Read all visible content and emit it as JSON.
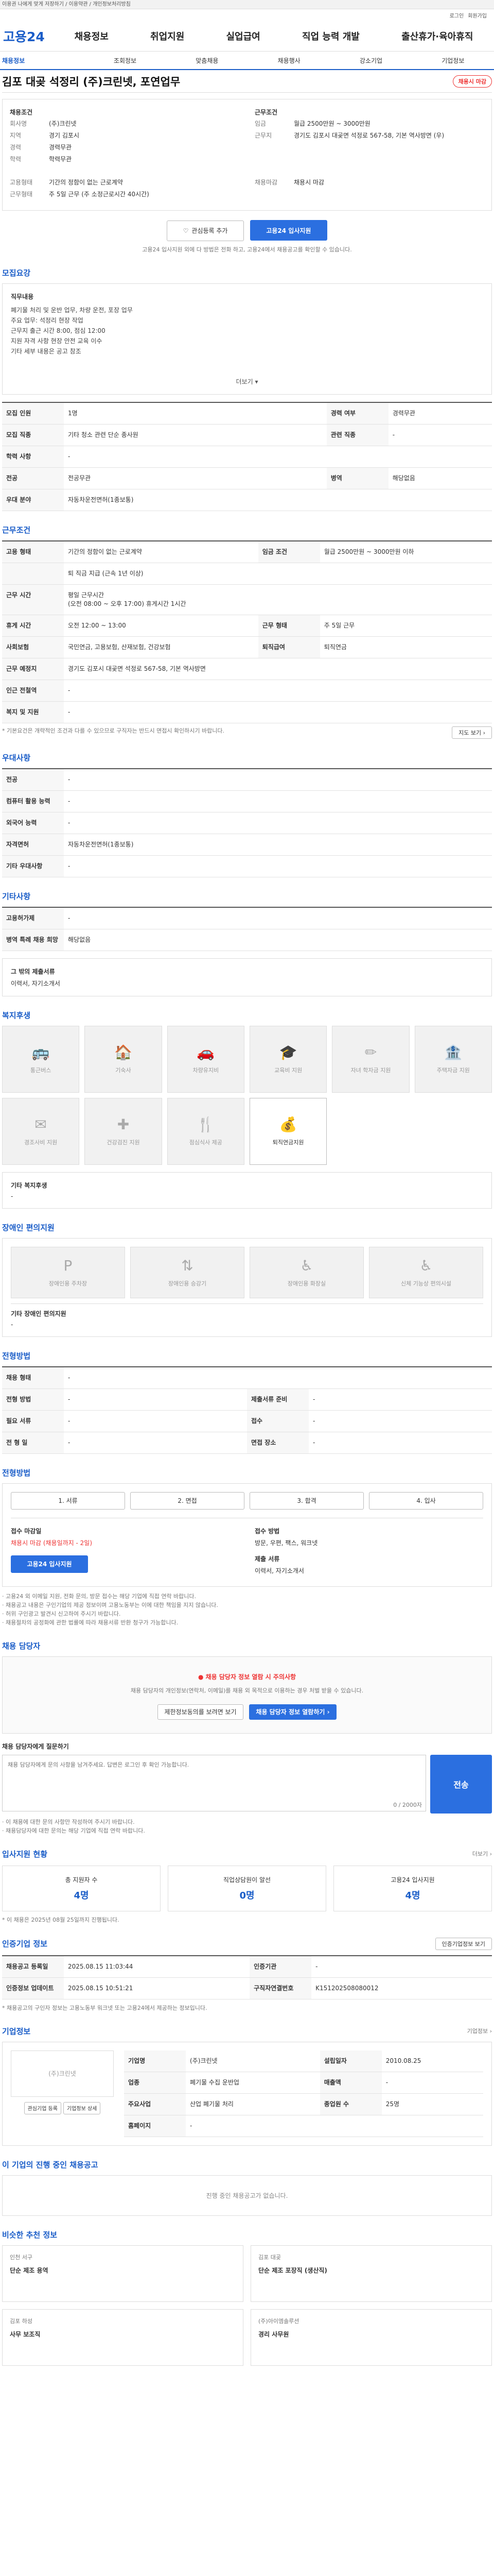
{
  "topbar": "이용권 나에게 맞게 저장하기 / 이용약관 / 개인정보처리방침",
  "util": [
    "로그인",
    "회원가입"
  ],
  "logo": "고용24",
  "gnb": [
    "채용정보",
    "취업지원",
    "실업급여",
    "직업 능력 개발",
    "출산휴가·육아휴직"
  ],
  "subnav": [
    "채용정보",
    "조회정보",
    "맞춤채용",
    "채용행사",
    "강소기업",
    "기업정보"
  ],
  "job": {
    "title": "김포 대곶 석정리 (주)크린넷, 포연업무",
    "badge": "채용시 마감",
    "left_label": "채용조건",
    "company_k": "회사명",
    "company": "(주)크린넷",
    "loc_k": "지역",
    "loc": "경기 김포시",
    "career_k": "경력",
    "career": "경력무관",
    "edu_k": "학력",
    "edu": "학력무관",
    "right_label": "근무조건",
    "pay_k": "임금",
    "pay": "월급 2500만원 ~ 3000만원",
    "addr_k": "근무지",
    "addr": "경기도 김포시 대곶면 석정로 567-58, 기본 역사방면 (우)",
    "emp_k": "고용형태",
    "emp": "기간의 정함이 없는 근로계약",
    "type_k": "근무형태",
    "type": "주 5일 근무 (주 소정근로시간 40시간)",
    "hire_label": "채용마감",
    "hire": "채용시 마감",
    "btn_save": "관심등록 추가",
    "btn_apply": "고용24 입사지원",
    "note": "고용24 입사지원 외에 다 방법은 전화 하고, 고용24에서 채용공고를 확인할 수 있습니다."
  },
  "recruit": {
    "title": "모집요강",
    "job_k": "직무내용",
    "job_v": "폐기물 처리 및 운반 업무, 차량 운전, 포장 업무\n주요 업무: 석정리 현장 작업\n근무지 출근 시간 8:00, 점심 12:00\n지원 자격 사항 현장 안전 교육 이수\n기타 세부 내용은 공고 참조",
    "more": "더보기 ▾",
    "rows": [
      [
        "모집 인원",
        "1명",
        "경력 여부",
        "경력무관"
      ],
      [
        "모집 직종",
        "기타 청소 관련 단순 종사원",
        "관련 직종",
        "-"
      ],
      [
        "학력 사항",
        "-",
        "",
        ""
      ],
      [
        "전공",
        "전공무관",
        "병역",
        "해당없음"
      ],
      [
        "우대 분야",
        "자동차운전면허(1종보통)",
        "",
        ""
      ]
    ]
  },
  "work": {
    "title": "근무조건",
    "rows": [
      [
        "고용 형태",
        "기간의 정함이 없는 근로계약",
        "임금 조건",
        "월급 2500만원 ~ 3000만원 이하"
      ],
      [
        "",
        "퇴 직금 지급 (근속 1년 이상)",
        "",
        ""
      ],
      [
        "근무 시간",
        "평일 근무시간\n(오전 08:00 ~ 오후 17:00) 휴게시간 1시간",
        "",
        ""
      ],
      [
        "휴게 시간",
        "오전 12:00 ~ 13:00",
        "근무 형태",
        "주 5일 근무"
      ],
      [
        "사회보험",
        "국민연금, 고용보험, 산재보험, 건강보험",
        "퇴직급여",
        "퇴직연금"
      ],
      [
        "근무 예정지",
        "경기도 김포시 대곶면 석정로 567-58, 기본 역사방면",
        "",
        ""
      ],
      [
        "인근 전철역",
        "-",
        "",
        ""
      ],
      [
        "복지 및 지원",
        "-",
        "",
        ""
      ]
    ],
    "note": "* 기본요건은 개략적인 조건과 다를 수 있으므로 구직자는 반드시 면접시 확인하시기 바랍니다.",
    "map_btn": "지도 보기 ›"
  },
  "pref": {
    "title": "우대사항",
    "rows": [
      [
        "전공",
        "-"
      ],
      [
        "컴퓨터 활용 능력",
        "-"
      ],
      [
        "외국어 능력",
        "-"
      ],
      [
        "자격면허",
        "자동차운전면허(1종보통)"
      ],
      [
        "기타 우대사항",
        "-"
      ]
    ]
  },
  "etc": {
    "title": "기타사항",
    "rows": [
      [
        "고용허가제",
        "-"
      ],
      [
        "병역 특례 채용 희망",
        "해당없음"
      ]
    ],
    "other_k": "그 밖의 제출서류",
    "other_v": "이력서, 자기소개서"
  },
  "welfare": {
    "title": "복지후생",
    "tiles": [
      "통근버스",
      "기숙사",
      "차량유지비",
      "교육비 지원",
      "자녀 학자금 지원",
      "주택자금 지원",
      "경조사비 지원",
      "건강검진 지원",
      "점심식사 제공",
      "퇴직연금지원"
    ],
    "active": [
      9
    ],
    "extra_k": "기타 복지후생",
    "extra_v": "-"
  },
  "disab": {
    "title": "장애인 편의지원",
    "tiles": [
      "장애인용 주차장",
      "장애인용 승강기",
      "장애인용 화장실",
      "신체 기능상 편의시설"
    ],
    "extra_k": "기타 장애인 편의지원",
    "extra_v": "-"
  },
  "process": {
    "title": "전형방법",
    "rows": [
      [
        "채용 형태",
        "-",
        "",
        ""
      ],
      [
        "전형 방법",
        "-",
        "제출서류 준비",
        "-"
      ],
      [
        "필요 서류",
        "-",
        "접수",
        "-"
      ],
      [
        "전 형 일",
        "-",
        "면접 장소",
        "-"
      ]
    ]
  },
  "steps": {
    "title": "전형방법",
    "list": [
      "서류",
      "면접",
      "합격",
      "입사"
    ],
    "recv_k": "접수 마감일",
    "recv_v": "채용시 마감 (채용일까지 - 2일)",
    "way_k": "접수 방법",
    "way_v": "방문, 우편, 팩스, 워크넷",
    "apply_btn": "고용24 입사지원",
    "doc_k": "제출 서류",
    "doc_v": "이력서, 자기소개서",
    "notes": [
      "· 고용24 외 이메일 지원, 전화 문의, 방문 접수는 해당 기업에 직접 연락 바랍니다.",
      "· 채용공고 내용은 구인기업의 제공 정보이며 고용노동부는 이에 대한 책임을 지지 않습니다.",
      "· 허위 구인광고 발견시 신고하여 주시기 바랍니다.",
      "· 채용절차의 공정화에 관한 법률에 따라 채용서류 반환 청구가 가능합니다."
    ]
  },
  "contact": {
    "title": "채용 담당자",
    "warn": "채용 담당자 정보 열람 시 주의사항",
    "warn_txt": "채용 담당자의 개인정보(연락처, 이메일)를 채용 외 목적으로 이용하는 경우 처벌 받을 수 있습니다.",
    "btn1": "제한정보동의를 보려면 보기",
    "btn2": "채용 담당자 정보 열람하기 ›",
    "q_k": "채용 담당자에게 질문하기",
    "q_ph": "채용 담당자에게 문의 사항을 남겨주세요. 답변은 로그인 후 확인 가능합니다.",
    "q_count": "0 / 2000자",
    "q_btn": "전송",
    "q_notes": [
      "· 이 채용에 대한 문의 사항만 작성하여 주시기 바랍니다.",
      "· 채용담당자에 대한 문의는 해당 기업에 직접 연락 바랍니다."
    ]
  },
  "stats": {
    "title": "입사지원 현황",
    "more": "더보기 ›",
    "cells": [
      [
        "총 지원자 수",
        "4명"
      ],
      [
        "직업상담원이 알선",
        "0명"
      ],
      [
        "고용24 입사지원",
        "4명"
      ]
    ],
    "note": "* 이 채용은 2025년 08월 25일까지 진행됩니다."
  },
  "info": {
    "title": "인증기업 정보",
    "btn": "인증기업정보 보기",
    "rows": [
      [
        "채용공고 등록일",
        "2025.08.15 11:03:44",
        "인증기관",
        "-"
      ],
      [
        "인증정보 업데이트",
        "2025.08.15 10:51:21",
        "구직자연결번호",
        "K151202508080012"
      ]
    ],
    "note": "* 채용공고의 구인자 정보는 고용노동부 워크넷 또는 고용24에서 제공하는 정보입니다."
  },
  "company": {
    "title": "기업정보",
    "more": "기업정보 ›",
    "logo": "(주)크린넷",
    "rows": [
      [
        "기업명",
        "(주)크린넷",
        "설립일자",
        "2010.08.25"
      ],
      [
        "업종",
        "폐기물 수집 운반업",
        "매출액",
        "-"
      ],
      [
        "주요사업",
        "산업 폐기물 처리",
        "종업원 수",
        "25명"
      ],
      [
        "홈페이지",
        "-",
        "",
        ""
      ]
    ],
    "btn1": "관심기업 등록",
    "btn2": "기업정보 상세"
  },
  "same": {
    "title": "이 기업의 진행 중인 채용공고",
    "empty": "진행 중인 채용공고가 없습니다."
  },
  "reco": {
    "title": "비슷한 추천 정보",
    "items": [
      [
        "인천 서구",
        "단순 제조 용역"
      ],
      [
        "김포 대곶",
        "단순 제조 포장직 (생산직)"
      ],
      [
        "김포 하성",
        "사무 보조직"
      ],
      [
        "(주)아이엠솔루션",
        "경리 사무원"
      ]
    ]
  }
}
